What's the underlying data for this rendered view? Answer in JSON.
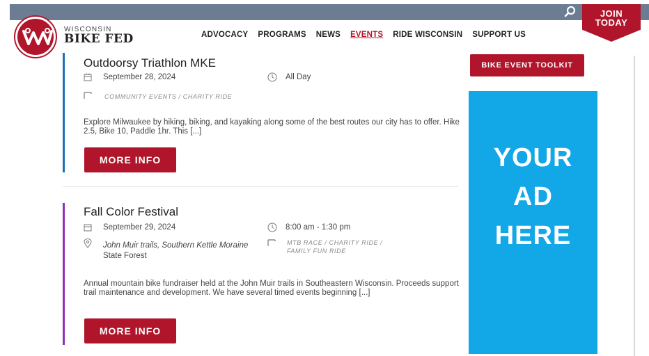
{
  "header": {
    "brand_small": "WISCONSIN",
    "brand_big": "BIKE FED",
    "join_line1": "JOIN",
    "join_line2": "TODAY",
    "nav": [
      {
        "label": "ADVOCACY"
      },
      {
        "label": "PROGRAMS"
      },
      {
        "label": "NEWS"
      },
      {
        "label": "EVENTS"
      },
      {
        "label": "RIDE WISCONSIN"
      },
      {
        "label": "SUPPORT US"
      }
    ],
    "active_nav": "EVENTS"
  },
  "events": [
    {
      "title": "Outdoorsy Triathlon MKE",
      "date": "September 28, 2024",
      "time": "All Day",
      "categories": "COMMUNITY EVENTS / CHARITY RIDE",
      "description": "Explore Milwaukee by hiking, biking, and kayaking along some of the best routes our city has to offer. Hike 2.5, Bike 10, Paddle 1hr. This [...]",
      "more_label": "MORE INFO",
      "accent": "#1f6fb8"
    },
    {
      "title": "Fall Color Festival",
      "date": "September 29, 2024",
      "time": "8:00 am - 1:30 pm",
      "location_line1": "John Muir trails, Southern Kettle Moraine",
      "location_line2": "State Forest",
      "categories_line1": "MTB RACE / CHARITY RIDE /",
      "categories_line2": "FAMILY FUN RIDE",
      "description": "Annual mountain bike fundraiser held at the John Muir trails in Southeastern Wisconsin. Proceeds support trail maintenance and development. We have several timed events beginning [...]",
      "more_label": "MORE INFO",
      "accent": "#8e2fb8"
    }
  ],
  "sidebar": {
    "toolkit_label": "BIKE EVENT TOOLKIT",
    "ad_line1": "YOUR",
    "ad_line2": "AD",
    "ad_line3": "HERE"
  },
  "colors": {
    "brand_red": "#b0152b",
    "ad_blue": "#12a7e6",
    "topbar": "#6b7c93"
  },
  "icons": [
    "search-icon",
    "logo-icon",
    "calendar-icon",
    "clock-icon",
    "folder-icon",
    "map-pin-icon"
  ]
}
